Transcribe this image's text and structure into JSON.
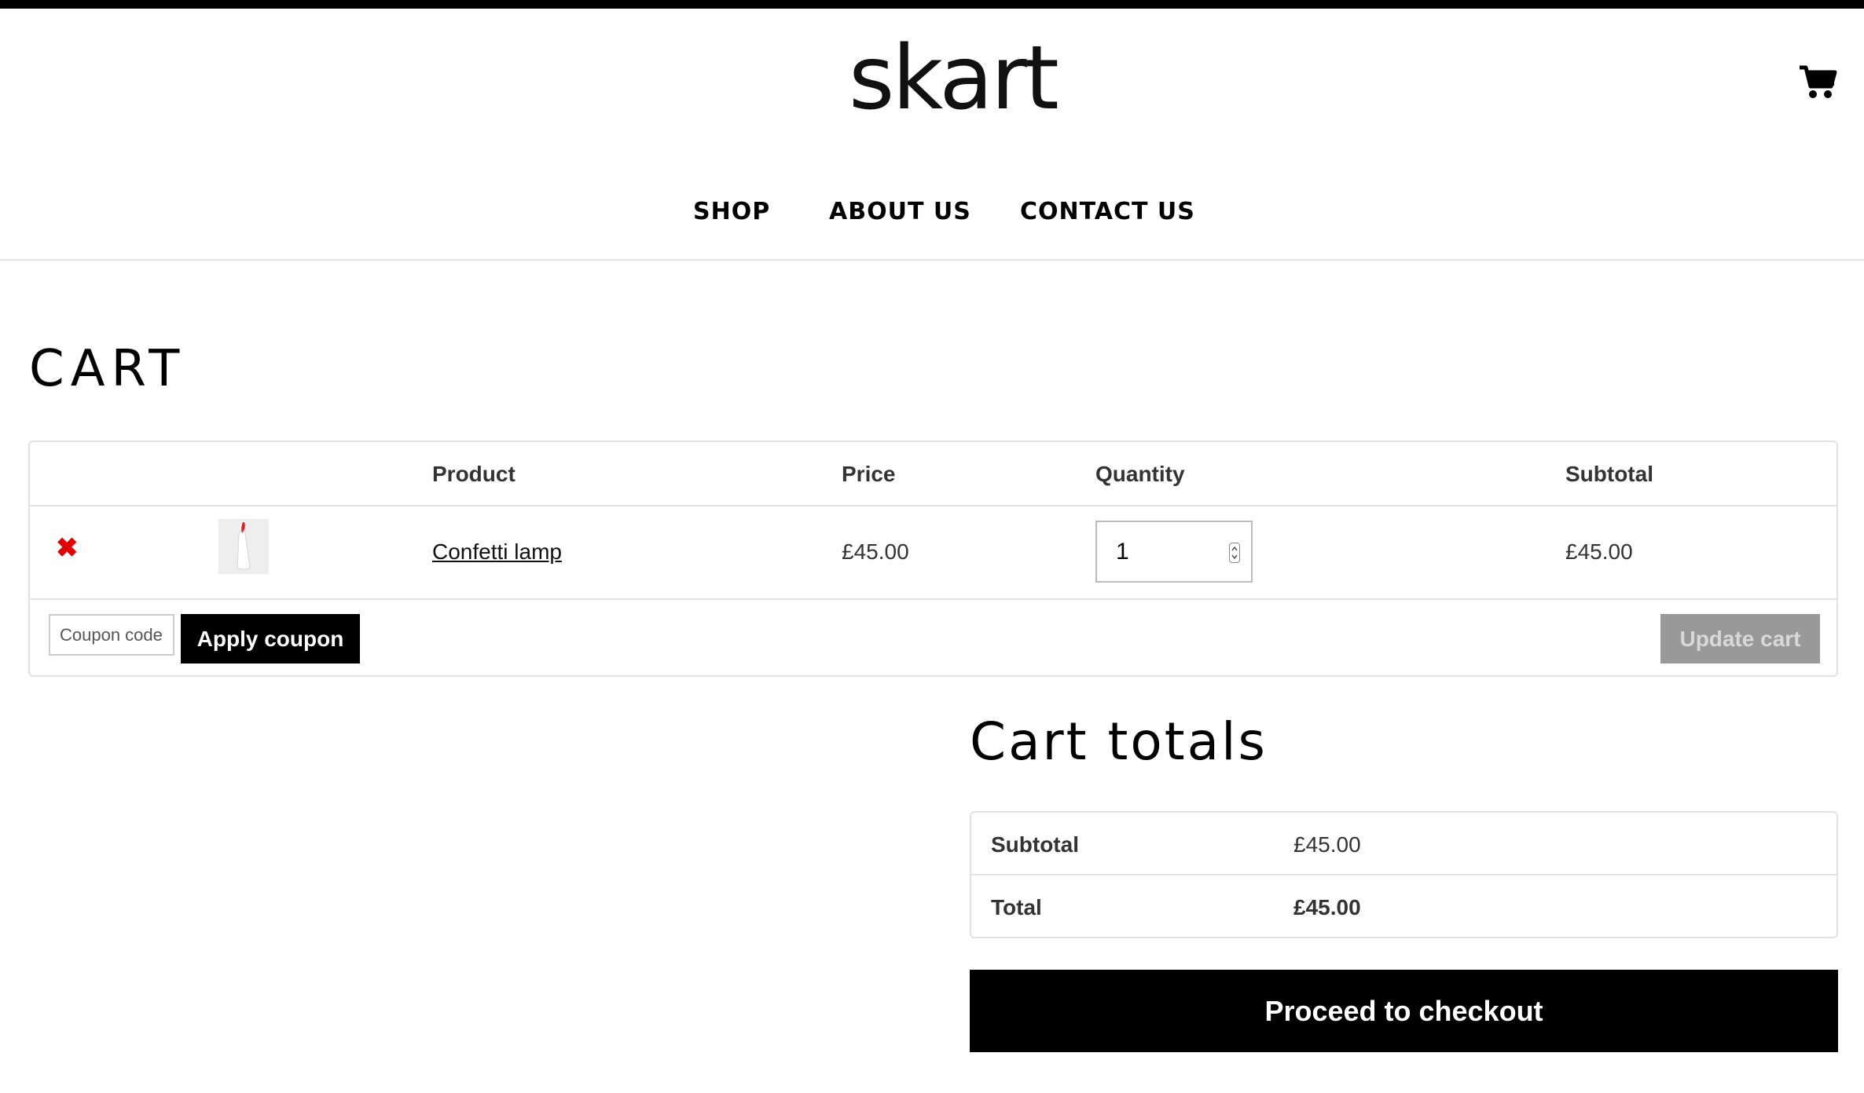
{
  "header": {
    "logo_text": "skart",
    "cart_icon": "shopping-cart-icon"
  },
  "nav": {
    "items": [
      {
        "label": "SHOP"
      },
      {
        "label": "ABOUT US"
      },
      {
        "label": "CONTACT US"
      }
    ]
  },
  "page": {
    "title": "CART"
  },
  "cart_table": {
    "headers": {
      "product": "Product",
      "price": "Price",
      "quantity": "Quantity",
      "subtotal": "Subtotal"
    },
    "rows": [
      {
        "remove_icon": "close-icon",
        "product_name": "Confetti lamp",
        "price": "£45.00",
        "quantity": "1",
        "subtotal": "£45.00"
      }
    ],
    "coupon_placeholder": "Coupon code",
    "apply_coupon_label": "Apply coupon",
    "update_cart_label": "Update cart"
  },
  "cart_totals": {
    "title": "Cart totals",
    "subtotal_label": "Subtotal",
    "subtotal_value": "£45.00",
    "total_label": "Total",
    "total_value": "£45.00",
    "checkout_label": "Proceed to checkout"
  },
  "colors": {
    "remove_red": "#e00000",
    "primary_button": "#000000",
    "disabled_button": "#999999"
  }
}
